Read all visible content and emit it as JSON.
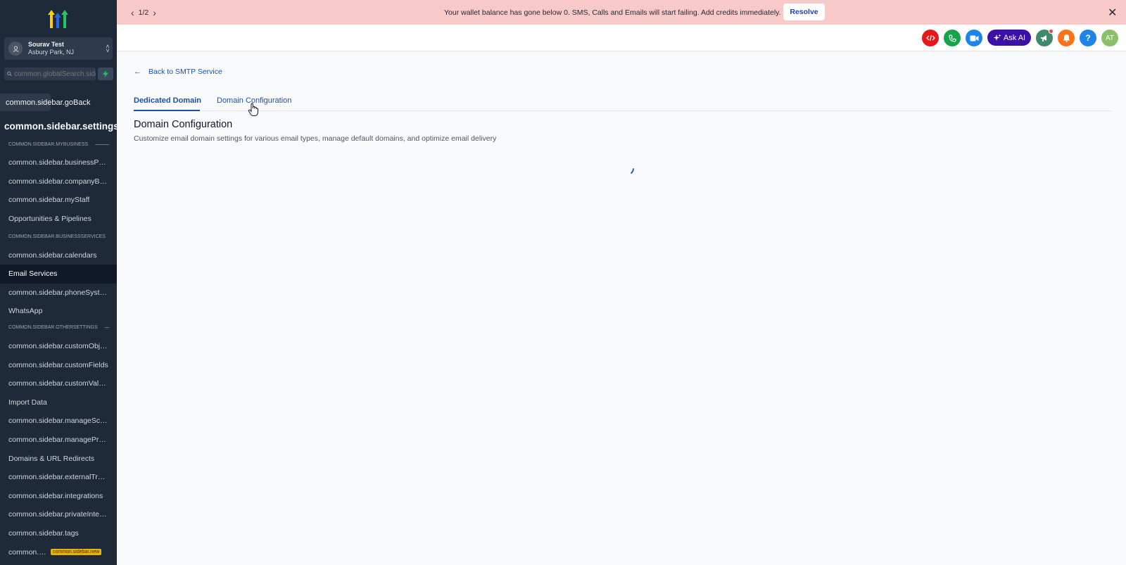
{
  "banner": {
    "pager": "1/2",
    "message": "Your wallet balance has gone below 0. SMS, Calls and Emails will start failing. Add credits immediately.",
    "resolve_label": "Resolve"
  },
  "sidebar": {
    "location_name": "Sourav Test",
    "location_city": "Asbury Park, NJ",
    "search_placeholder": "common.globalSearch.sidebar",
    "go_back": "common.sidebar.goBack",
    "settings_title": "common.sidebar.settings",
    "section_mybusiness": "COMMON.SIDEBAR.MYBUSINESS",
    "section_businessservices": "COMMON.SIDEBAR.BUSINESSSERVICES",
    "section_othersettings": "COMMON.SIDEBAR.OTHERSETTINGS",
    "items": [
      "common.sidebar.businessProfile",
      "common.sidebar.companyBilling",
      "common.sidebar.myStaff",
      "Opportunities & Pipelines",
      "common.sidebar.calendars",
      "Email Services",
      "common.sidebar.phoneSystem",
      "WhatsApp",
      "common.sidebar.customObjects",
      "common.sidebar.customFields",
      "common.sidebar.customValues",
      "Import Data",
      "common.sidebar.manageScoring",
      "common.sidebar.managePreferences",
      "Domains & URL Redirects",
      "common.sidebar.externalTracking",
      "common.sidebar.integrations",
      "common.sidebar.privateIntegrations",
      "common.sidebar.tags",
      "common.sidebar.labs"
    ],
    "new_badge": "common.sidebar.new"
  },
  "header": {
    "ask_ai_label": "Ask AI",
    "avatar_initials": "AT",
    "help_label": "?",
    "colors": {
      "code": "#e5181b",
      "phone": "#16a34a",
      "video": "#1d84e9",
      "megaphone": "#3d8b6a",
      "bell": "#f97316",
      "help": "#1d84e9",
      "avatar": "#8bbf6a"
    }
  },
  "main": {
    "back_link": "Back to SMTP Service",
    "tabs": [
      "Dedicated Domain",
      "Domain Configuration"
    ],
    "heading": "Domain Configuration",
    "subheading": "Customize email domain settings for various email types, manage default domains, and optimize email delivery"
  }
}
